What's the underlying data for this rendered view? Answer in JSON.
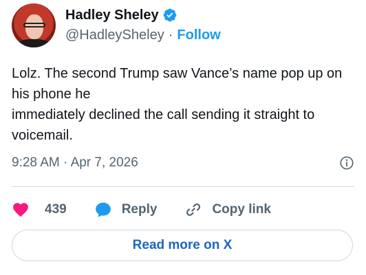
{
  "author": {
    "name": "Hadley Sheley",
    "handle": "@HadleySheley",
    "separator": "·",
    "follow_label": "Follow"
  },
  "tweet": {
    "text": "Lolz. The second Trump saw Vance’s name pop up on his phone he\nimmediately declined the call sending it straight to voicemail.",
    "time": "9:28 AM",
    "separator": "·",
    "date": "Apr 7, 2026"
  },
  "actions": {
    "like_count": "439",
    "reply_label": "Reply",
    "copy_link_label": "Copy link"
  },
  "read_more_label": "Read more on X",
  "colors": {
    "accent": "#1d9bf0",
    "like": "#f91880",
    "read_more_text": "#1d65c1",
    "secondary_text": "#536471"
  },
  "icons": [
    "verified-badge-icon",
    "info-icon",
    "heart-icon",
    "reply-bubble-icon",
    "link-icon"
  ]
}
